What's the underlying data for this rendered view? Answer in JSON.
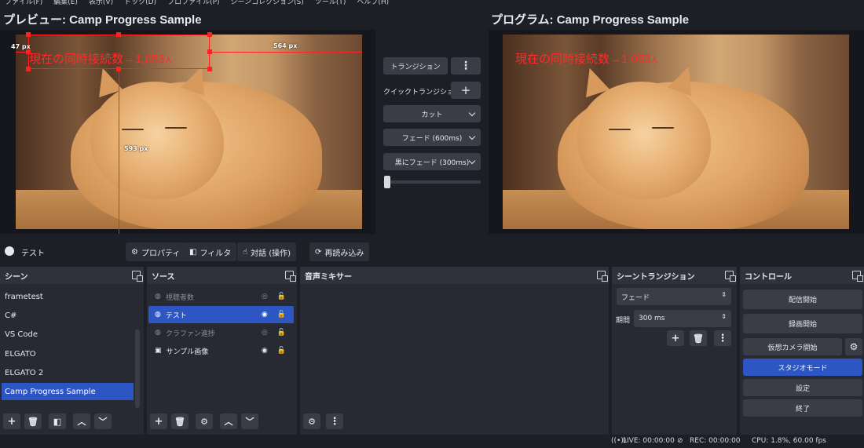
{
  "menu": [
    "ファイル(F)",
    "編集(E)",
    "表示(V)",
    "ドック(D)",
    "プロファイル(P)",
    "シーンコレクション(S)",
    "ツール(T)",
    "ヘルプ(H)"
  ],
  "preview": {
    "title": "プレビュー: Camp Progress Sample",
    "overlay_text": "現在の同時接続数→1,053",
    "overlay_suffix": "人",
    "measure_left": "47 px",
    "measure_right": "564 px",
    "measure_bottom": "593 px"
  },
  "program": {
    "title": "プログラム: Camp Progress Sample",
    "overlay_text": "現在の同時接続数→1,053",
    "overlay_suffix": "人"
  },
  "transition_panel": {
    "transition_label": "トランジション",
    "quick_transition_label": "クイックトランジション",
    "items": [
      "カット",
      "フェード (600ms)",
      "黒にフェード (300ms)"
    ]
  },
  "toolbar": {
    "selected_source": "テスト",
    "properties": "プロパティ",
    "filters": "フィルタ",
    "interact": "対話 (操作)",
    "reload": "再読み込み"
  },
  "scenes": {
    "title": "シーン",
    "items": [
      "frametest",
      "C#",
      "VS Code",
      "ELGATO",
      "ELGATO 2",
      "Camp Progress Sample"
    ],
    "selected_index": 5
  },
  "sources": {
    "title": "ソース",
    "items": [
      {
        "name": "視聴者数",
        "icon": "browser-icon",
        "visible": false,
        "selected": false
      },
      {
        "name": "テスト",
        "icon": "browser-icon",
        "visible": true,
        "selected": true
      },
      {
        "name": "クラファン進捗",
        "icon": "browser-icon",
        "visible": false,
        "selected": false
      },
      {
        "name": "サンプル画像",
        "icon": "image-icon",
        "visible": true,
        "selected": false
      }
    ]
  },
  "mixer": {
    "title": "音声ミキサー"
  },
  "scene_transitions": {
    "title": "シーントランジション",
    "type": "フェード",
    "duration_label": "期間",
    "duration_value": "300 ms"
  },
  "controls": {
    "title": "コントロール",
    "start_streaming": "配信開始",
    "start_recording": "録画開始",
    "start_virtual_camera": "仮想カメラ開始",
    "studio_mode": "スタジオモード",
    "settings": "設定",
    "exit": "終了"
  },
  "status": {
    "live": "LIVE: 00:00:00",
    "rec": "REC: 00:00:00",
    "cpu": "CPU: 1.8%, 60.00 fps"
  },
  "colors": {
    "accent": "#2d56c4",
    "overlay_red": "#ff2b2b",
    "guide_red": "#ff2020"
  }
}
